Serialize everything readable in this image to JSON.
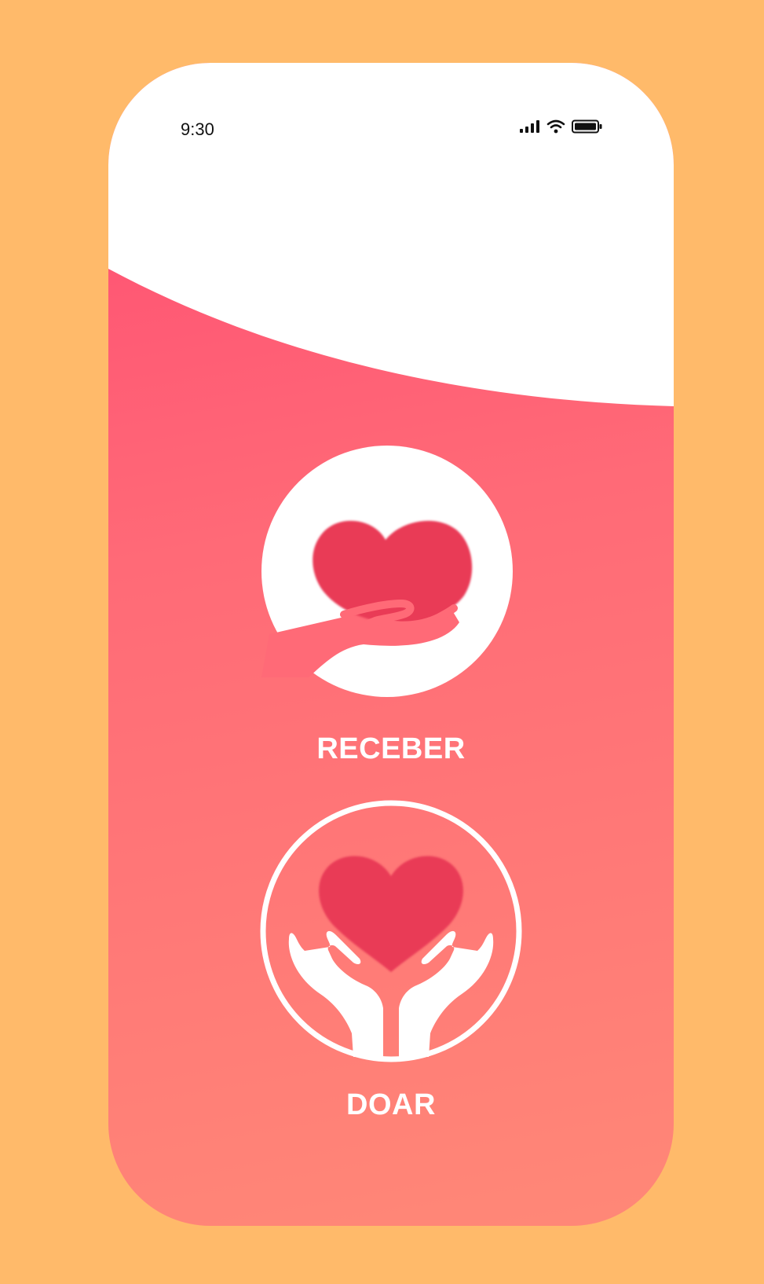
{
  "status_bar": {
    "time": "9:30",
    "icons": [
      "signal-icon",
      "wifi-icon",
      "battery-icon"
    ]
  },
  "options": {
    "receive_label": "RECEBER",
    "donate_label": "DOAR"
  },
  "colors": {
    "background": "#FFBA6A",
    "gradient_top": "#FF4B72",
    "gradient_bottom": "#FF8877",
    "heart": "#E93A57",
    "label": "#FFFFFF"
  }
}
